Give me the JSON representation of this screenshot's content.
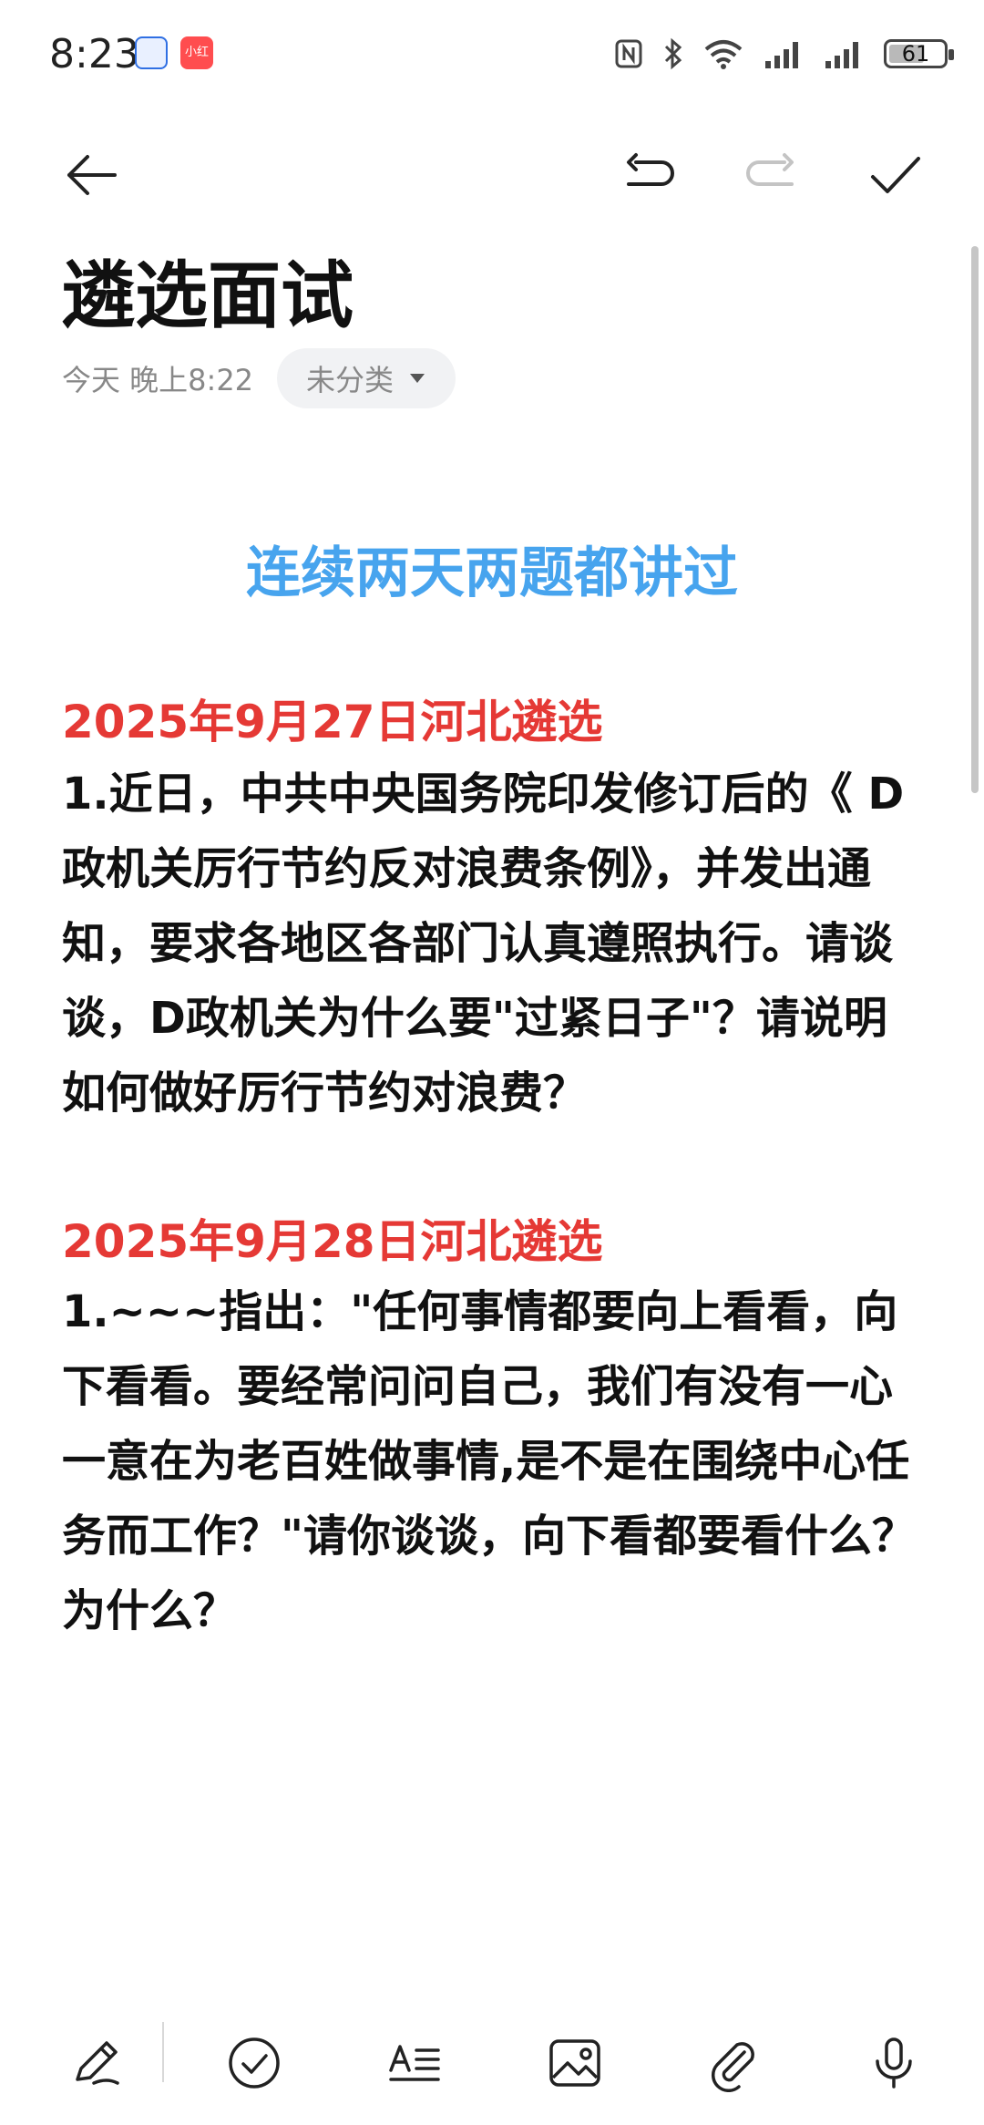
{
  "status": {
    "time": "8:23",
    "badge_app2": "小红书",
    "battery": "61"
  },
  "note": {
    "title": "遴选面试",
    "date": "今天 晚上8:22",
    "category": "未分类",
    "heading": "连续两天两题都讲过",
    "entries": [
      {
        "date": "2025年9月27日河北遴选",
        "text": "1.近日，中共中央国务院印发修订后的《 D政机关厉行节约反对浪费条例》，并发出通知，要求各地区各部门认真遵照执行。请谈谈，D政机关为什么要\"过紧日子\"？请说明如何做好厉行节约对浪费？"
      },
      {
        "date": "2025年9月28日河北遴选",
        "text": "1.~~~指出：\"任何事情都要向上看看，向下看看。要经常问问自己，我们有没有一心一意在为老百姓做事情,是不是在围绕中心任务而工作？\"请你谈谈，向下看都要看什么？为什么？"
      }
    ]
  },
  "colors": {
    "heading": "#47a4ee",
    "date_red": "#e53935"
  }
}
